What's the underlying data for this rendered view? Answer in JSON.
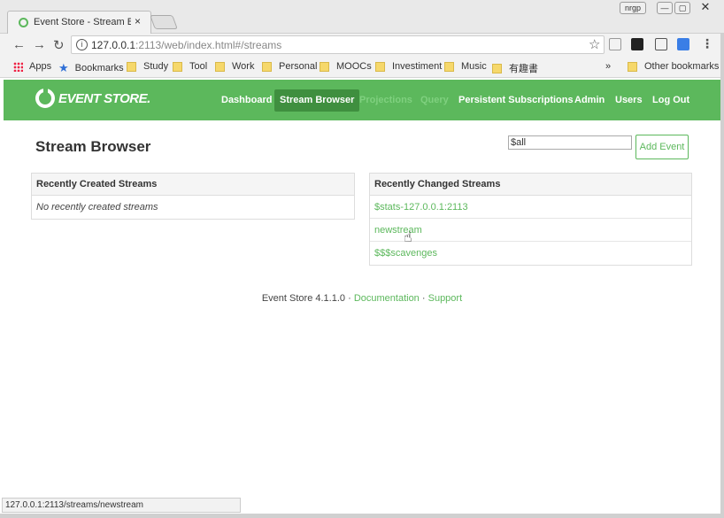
{
  "browser": {
    "tab_title": "Event Store - Stream Browser",
    "tab_close": "×",
    "url_host": "127.0.0.1",
    "url_rest": ":2113/web/index.html#/streams",
    "window_buttons": {
      "user": "nrgp",
      "minimize": "—",
      "maximize": "▢",
      "close": "✕"
    },
    "nav": {
      "back": "←",
      "forward": "→",
      "reload": "↻"
    },
    "star": "☆",
    "menu": "⋮",
    "bookmarks": [
      {
        "label": "Apps",
        "icon": "apps-icon"
      },
      {
        "label": "Bookmarks",
        "icon": "star-icon"
      },
      {
        "label": "Study",
        "icon": "folder-icon"
      },
      {
        "label": "Tool",
        "icon": "folder-icon"
      },
      {
        "label": "Work",
        "icon": "folder-icon"
      },
      {
        "label": "Personal",
        "icon": "folder-icon"
      },
      {
        "label": "MOOCs",
        "icon": "folder-icon"
      },
      {
        "label": "Investiment",
        "icon": "folder-icon"
      },
      {
        "label": "Music",
        "icon": "folder-icon"
      },
      {
        "label": "有趣書",
        "icon": "folder-icon"
      }
    ],
    "bookmarks_overflow": "»",
    "other_bookmarks": "Other bookmarks",
    "status_url": "127.0.0.1:2113/streams/newstream"
  },
  "app": {
    "logo_text": "EVENT STORE.",
    "nav": [
      {
        "label": "Dashboard",
        "state": "normal"
      },
      {
        "label": "Stream Browser",
        "state": "active"
      },
      {
        "label": "Projections",
        "state": "disabled"
      },
      {
        "label": "Query",
        "state": "disabled"
      },
      {
        "label": "Persistent Subscriptions",
        "state": "normal"
      },
      {
        "label": "Admin",
        "state": "normal"
      },
      {
        "label": "Users",
        "state": "normal"
      },
      {
        "label": "Log Out",
        "state": "normal"
      }
    ],
    "brand_color": "#5cb85c"
  },
  "main": {
    "title": "Stream Browser",
    "stream_input_value": "$all",
    "add_event_label": "Add Event",
    "recently_created": {
      "heading": "Recently Created Streams",
      "empty_text": "No recently created streams"
    },
    "recently_changed": {
      "heading": "Recently Changed Streams",
      "streams": [
        "$stats-127.0.0.1:2113",
        "newstream",
        "$$$scavenges"
      ]
    }
  },
  "footer": {
    "version": "Event Store 4.1.1.0",
    "sep": "·",
    "documentation": "Documentation",
    "support": "Support"
  }
}
